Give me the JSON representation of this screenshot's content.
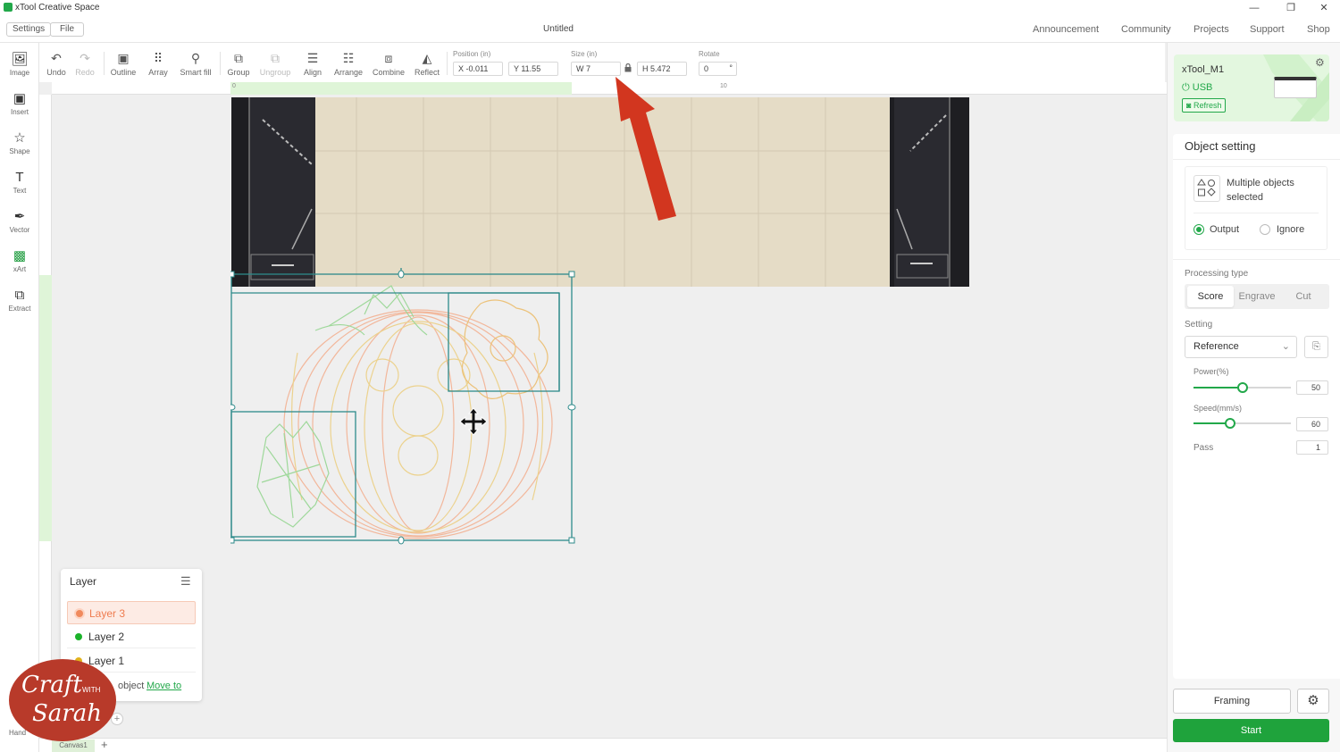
{
  "app": {
    "title": "xTool Creative Space",
    "doc_title": "Untitled"
  },
  "menubar": {
    "settings": "Settings",
    "file": "File",
    "links": [
      "Announcement",
      "Community",
      "Projects",
      "Support",
      "Shop"
    ]
  },
  "toolbar": {
    "undo": "Undo",
    "redo": "Redo",
    "outline": "Outline",
    "array": "Array",
    "smart_fill": "Smart fill",
    "group": "Group",
    "ungroup": "Ungroup",
    "align": "Align",
    "arrange": "Arrange",
    "combine": "Combine",
    "reflect": "Reflect",
    "position_label": "Position (in)",
    "x_value": "X -0.011",
    "y_value": "Y 11.55",
    "size_label": "Size (in)",
    "w_value": "W 7",
    "h_value": "H 5.472",
    "rotate_label": "Rotate",
    "rotate_value": "0",
    "rotate_unit": "°"
  },
  "ruler": {
    "tick_0": "0",
    "tick_10": "10"
  },
  "leftbar": [
    "Image",
    "Insert",
    "Shape",
    "Text",
    "Vector",
    "xArt",
    "Extract"
  ],
  "leftbar_bottom": "Hand",
  "layer_panel": {
    "title": "Layer",
    "layers": [
      {
        "name": "Layer 3",
        "color": "#f08a5d"
      },
      {
        "name": "Layer 2",
        "color": "#1bb32a"
      },
      {
        "name": "Layer 1",
        "color": "#e2b21b"
      }
    ],
    "move_text": "object",
    "move_link": "Move to"
  },
  "canvas_tab": {
    "name": "Canvas1",
    "add": "+"
  },
  "device": {
    "name": "xTool_M1",
    "connection": "USB",
    "refresh": "Refresh"
  },
  "object_setting": {
    "title": "Object setting",
    "selection_line1": "Multiple objects",
    "selection_line2": "selected",
    "output": "Output",
    "ignore": "Ignore",
    "processing_type_label": "Processing type",
    "types": [
      "Score",
      "Engrave",
      "Cut"
    ],
    "active_type": "Score",
    "setting_label": "Setting",
    "setting_value": "Reference",
    "power_label": "Power(%)",
    "power_value": "50",
    "power_level": 0.5,
    "speed_label": "Speed(mm/s)",
    "speed_value": "60",
    "speed_level": 0.38,
    "pass_label": "Pass",
    "pass_value": "1"
  },
  "footer": {
    "framing": "Framing",
    "start": "Start"
  },
  "watermark": {
    "line1": "Craft",
    "with": "WITH",
    "line2": "Sarah"
  },
  "colors": {
    "accent": "#22a84a",
    "arrow": "#d2361f",
    "selection": "#2d8a8a",
    "watermark": "#b83a2a"
  }
}
